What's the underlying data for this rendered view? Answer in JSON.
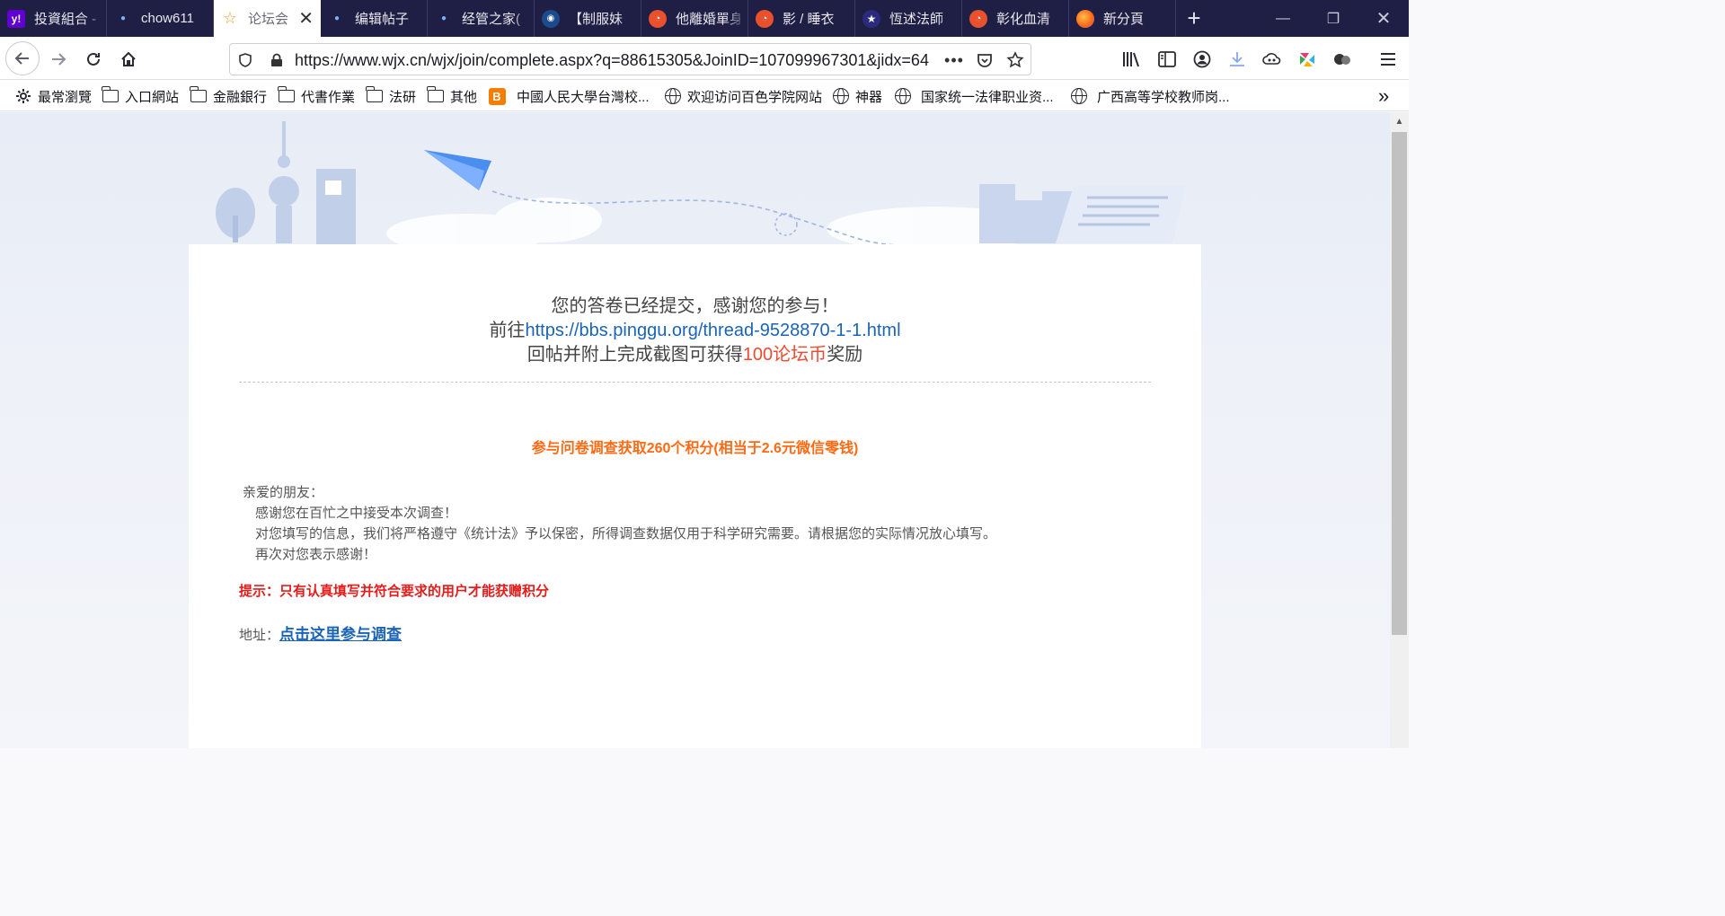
{
  "tabs": [
    {
      "label": "投資組合 -",
      "icon": "yahoo-icon",
      "active": false
    },
    {
      "label": "chow611",
      "icon": "dot-icon",
      "active": false
    },
    {
      "label": "论坛会",
      "icon": "star-outline-icon",
      "active": true
    },
    {
      "label": "编辑帖子",
      "icon": "dot-icon",
      "active": false
    },
    {
      "label": "经管之家(",
      "icon": "dot-icon",
      "active": false
    },
    {
      "label": "【制服妹",
      "icon": "circle-logo-icon",
      "active": false
    },
    {
      "label": "他離婚單身",
      "icon": "red-circle-icon",
      "active": false
    },
    {
      "label": "影 / 睡衣",
      "icon": "red-circle-icon",
      "active": false
    },
    {
      "label": "恆述法師",
      "icon": "star-icon",
      "active": false
    },
    {
      "label": "彰化血清",
      "icon": "red-circle-icon",
      "active": false
    },
    {
      "label": "新分頁",
      "icon": "firefox-icon",
      "active": false
    }
  ],
  "navbar": {
    "url": "https://www.wjx.cn/wjx/join/complete.aspx?q=88615305&JoinID=107099967301&jidx=64"
  },
  "bookmarks": [
    {
      "label": "最常瀏覽",
      "icon": "gear-icon"
    },
    {
      "label": "入口網站",
      "icon": "folder-icon"
    },
    {
      "label": "金融銀行",
      "icon": "folder-icon"
    },
    {
      "label": "代書作業",
      "icon": "folder-icon"
    },
    {
      "label": "法研",
      "icon": "folder-icon"
    },
    {
      "label": "其他",
      "icon": "folder-icon"
    },
    {
      "label": "中國人民大學台灣校...",
      "icon": "blogger-icon"
    },
    {
      "label": "欢迎访问百色学院网站",
      "icon": "globe-icon"
    },
    {
      "label": "神器",
      "icon": "globe-icon"
    },
    {
      "label": "国家统一法律职业资...",
      "icon": "globe-icon"
    },
    {
      "label": "广西高等学校教师岗...",
      "icon": "globe-icon"
    }
  ],
  "page": {
    "line1": "您的答卷已经提交，感谢您的参与！",
    "line2_prefix": "前往",
    "line2_link": "https://bbs.pinggu.org/thread-9528870-1-1.html",
    "line3_prefix": "回帖并附上完成截图可获得",
    "line3_highlight": "100论坛币",
    "line3_suffix": "奖励",
    "headline": "参与问卷调查获取260个积分(相当于2.6元微信零钱)",
    "greeting": "亲爱的朋友：",
    "intro_lines": [
      "感谢您在百忙之中接受本次调查！",
      "对您填写的信息，我们将严格遵守《统计法》予以保密，所得调查数据仅用于科学研究需要。请根据您的实际情况放心填写。",
      "再次对您表示感谢！"
    ],
    "tip": "提示：只有认真填写并符合要求的用户才能获赠积分",
    "address_label": "地址：",
    "address_link": "点击这里参与调查"
  }
}
